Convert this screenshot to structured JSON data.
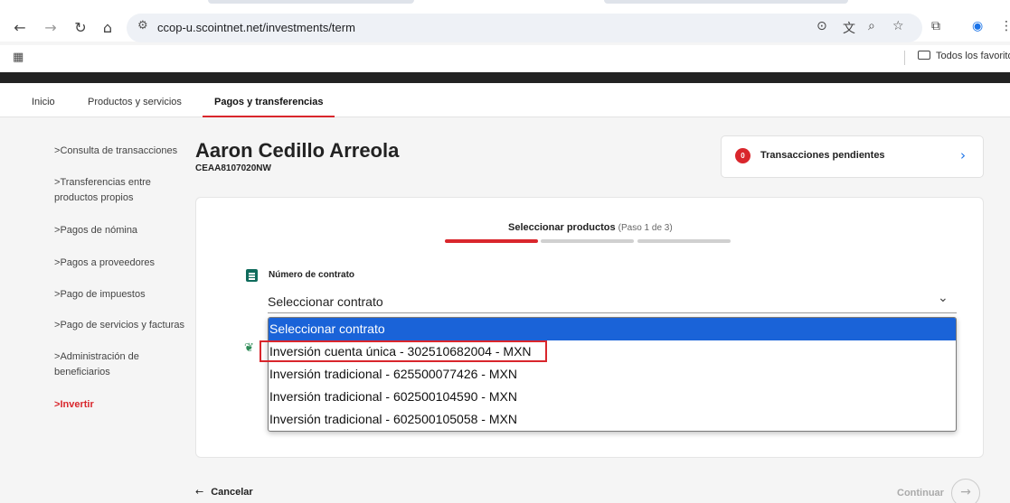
{
  "browser": {
    "url": "ccop-u.scointnet.net/investments/term",
    "bookmarks_label": "Todos los favorito"
  },
  "site_nav": {
    "items": [
      "Inicio",
      "Productos y servicios",
      "Pagos y transferencias"
    ],
    "active_index": 2
  },
  "sidebar": {
    "items": [
      {
        "label": "Consulta de transacciones"
      },
      {
        "label": "Transferencias entre productos propios"
      },
      {
        "label": "Pagos de nómina"
      },
      {
        "label": "Pagos a proveedores"
      },
      {
        "label": "Pago de impuestos"
      },
      {
        "label": "Pago de servicios y facturas"
      },
      {
        "label": "Administración de beneficiarios"
      },
      {
        "label": "Invertir"
      }
    ],
    "prefix": ">",
    "active": "Invertir"
  },
  "client": {
    "name": "Aaron Cedillo Arreola",
    "rfc": "CEAA8107020NW"
  },
  "pending": {
    "count": "0",
    "label": "Transacciones pendientes"
  },
  "step": {
    "title": "Seleccionar productos",
    "subtitle": "(Paso 1 de 3)",
    "current": 1,
    "total": 3
  },
  "contract": {
    "label": "Número de contrato",
    "placeholder": "Seleccionar contrato",
    "options": [
      "Seleccionar contrato",
      "Inversión cuenta única - 302510682004 - MXN",
      "Inversión tradicional - 625500077426 - MXN",
      "Inversión tradicional - 602500104590 - MXN",
      "Inversión tradicional - 602500105058 - MXN"
    ],
    "selected_index": 0,
    "highlighted_index": 1
  },
  "footer": {
    "cancel_label": "Cancelar",
    "continue_label": "Continuar"
  },
  "colors": {
    "accent_red": "#d9262c",
    "select_blue": "#1a63d8",
    "icon_green": "#0f6b5c"
  }
}
